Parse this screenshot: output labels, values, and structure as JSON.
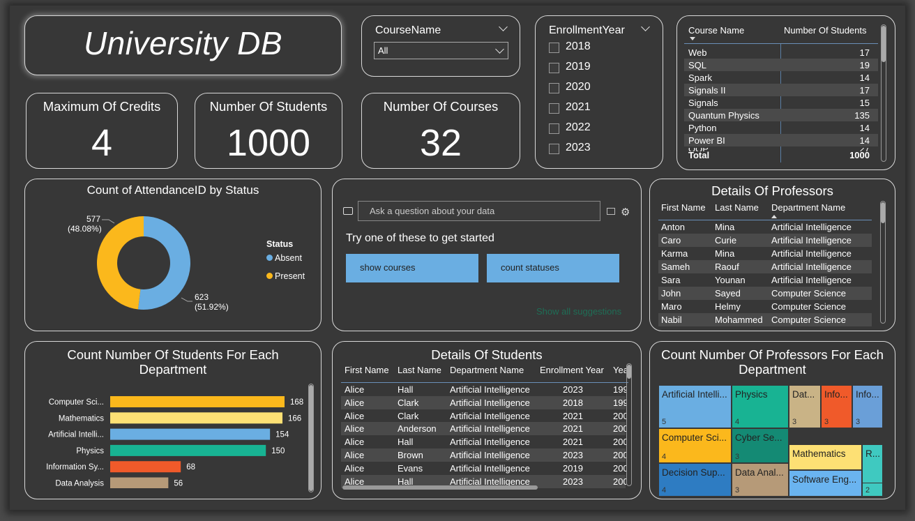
{
  "header": {
    "title": "University DB"
  },
  "course_slicer": {
    "label": "CourseName",
    "selected": "All"
  },
  "year_slicer": {
    "label": "EnrollmentYear",
    "years": [
      "2018",
      "2019",
      "2020",
      "2021",
      "2022",
      "2023"
    ]
  },
  "kpis": {
    "max_credits": {
      "label": "Maximum Of Credits",
      "value": "4"
    },
    "num_students": {
      "label": "Number Of Students",
      "value": "1000"
    },
    "num_courses": {
      "label": "Number Of Courses",
      "value": "32"
    }
  },
  "course_table": {
    "headers": [
      "Course Name",
      "Number Of Students"
    ],
    "rows": [
      [
        "Web",
        "17"
      ],
      [
        "SQL",
        "19"
      ],
      [
        "Spark",
        "14"
      ],
      [
        "Signals II",
        "17"
      ],
      [
        "Signals",
        "15"
      ],
      [
        "Quantum Physics",
        "135"
      ],
      [
        "Python",
        "14"
      ],
      [
        "Power BI",
        "14"
      ]
    ],
    "partial_row": "OOP",
    "partial_value": "27",
    "total_label": "Total",
    "total_value": "1000"
  },
  "attendance": {
    "title": "Count of AttendanceID by Status",
    "legend_title": "Status",
    "chart_data": {
      "type": "pie",
      "title": "Count of AttendanceID by Status",
      "categories": [
        "Absent",
        "Present"
      ],
      "values": [
        623,
        577
      ],
      "percent_labels": [
        "(51.92%)",
        "(48.08%)"
      ],
      "colors": [
        "#6aaee2",
        "#fbb81c"
      ]
    },
    "absent_value_label": "623",
    "absent_pct_label": "(51.92%)",
    "present_value_label": "577",
    "present_pct_label": "(48.08%)",
    "legend": [
      "Absent",
      "Present"
    ]
  },
  "qa": {
    "placeholder": "Ask a question about your data",
    "prompt": "Try one of these to get started",
    "suggestions": [
      "show courses",
      "count statuses"
    ],
    "show_all": "Show all suggestions"
  },
  "professors": {
    "title": "Details Of Professors",
    "headers": [
      "First Name",
      "Last Name",
      "Department Name"
    ],
    "rows": [
      [
        "Anton",
        "Mina",
        "Artificial Intelligence"
      ],
      [
        "Caro",
        "Curie",
        "Artificial Intelligence"
      ],
      [
        "Karma",
        "Mina",
        "Artificial Intelligence"
      ],
      [
        "Sameh",
        "Raouf",
        "Artificial Intelligence"
      ],
      [
        "Sara",
        "Younan",
        "Artificial Intelligence"
      ],
      [
        "John",
        "Sayed",
        "Computer Science"
      ],
      [
        "Maro",
        "Helmy",
        "Computer Science"
      ],
      [
        "Nabil",
        "Mohammed",
        "Computer Science"
      ]
    ]
  },
  "dept_students": {
    "title_line1": "Count Number Of Students For Each",
    "title_line2": "Department",
    "chart_data": {
      "type": "bar",
      "orientation": "horizontal",
      "title": "Count Number Of Students For Each Department",
      "categories": [
        "Computer Sci...",
        "Mathematics",
        "Artificial Intelli...",
        "Physics",
        "Information Sy...",
        "Data Analysis"
      ],
      "values": [
        168,
        166,
        154,
        150,
        68,
        56
      ],
      "colors": [
        "#fbb81c",
        "#fde074",
        "#6aaee2",
        "#18b393",
        "#f05a2a",
        "#b69a78"
      ],
      "xlim": [
        0,
        168
      ]
    }
  },
  "students": {
    "title": "Details Of Students",
    "headers": [
      "First Name",
      "Last Name",
      "Department Name",
      "Enrollment Year",
      "Yea"
    ],
    "rows": [
      [
        "Alice",
        "Hall",
        "Artificial Intelligence",
        "2023",
        "199"
      ],
      [
        "Alice",
        "Clark",
        "Artificial Intelligence",
        "2018",
        "199"
      ],
      [
        "Alice",
        "Clark",
        "Artificial Intelligence",
        "2021",
        "200"
      ],
      [
        "Alice",
        "Anderson",
        "Artificial Intelligence",
        "2021",
        "200"
      ],
      [
        "Alice",
        "Hall",
        "Artificial Intelligence",
        "2021",
        "200"
      ],
      [
        "Alice",
        "Brown",
        "Artificial Intelligence",
        "2023",
        "200"
      ],
      [
        "Alice",
        "Evans",
        "Artificial Intelligence",
        "2019",
        "200"
      ],
      [
        "Alice",
        "Hall",
        "Artificial Intelligence",
        "2023",
        "200"
      ]
    ]
  },
  "dept_professors": {
    "title_line1": "Count Number Of Professors For Each",
    "title_line2": "Department",
    "cells": [
      {
        "label": "Artificial Intelli...",
        "value": "5",
        "color": "#6aaee2"
      },
      {
        "label": "Physics",
        "value": "4",
        "color": "#18b393"
      },
      {
        "label": "Dat...",
        "value": "3",
        "color": "#c9b386"
      },
      {
        "label": "Info...",
        "value": "3",
        "color": "#f05a2a"
      },
      {
        "label": "Info...",
        "value": "3",
        "color": "#6a9fd8"
      },
      {
        "label": "Computer Sci...",
        "value": "4",
        "color": "#fbb81c"
      },
      {
        "label": "Cyber Se...",
        "value": "3",
        "color": "#148a74"
      },
      {
        "label": "Mathematics",
        "value": "",
        "color": "#fde074"
      },
      {
        "label": "R...",
        "value": "",
        "color": "#3fc9c0"
      },
      {
        "label": "Decision Sup...",
        "value": "4",
        "color": "#2e7cc2"
      },
      {
        "label": "Data Anal...",
        "value": "3",
        "color": "#b69a78"
      },
      {
        "label": "Software Eng...",
        "value": "",
        "color": "#6ab4f0"
      },
      {
        "label": "",
        "value": "2",
        "color": "#3fc9c0"
      }
    ]
  }
}
